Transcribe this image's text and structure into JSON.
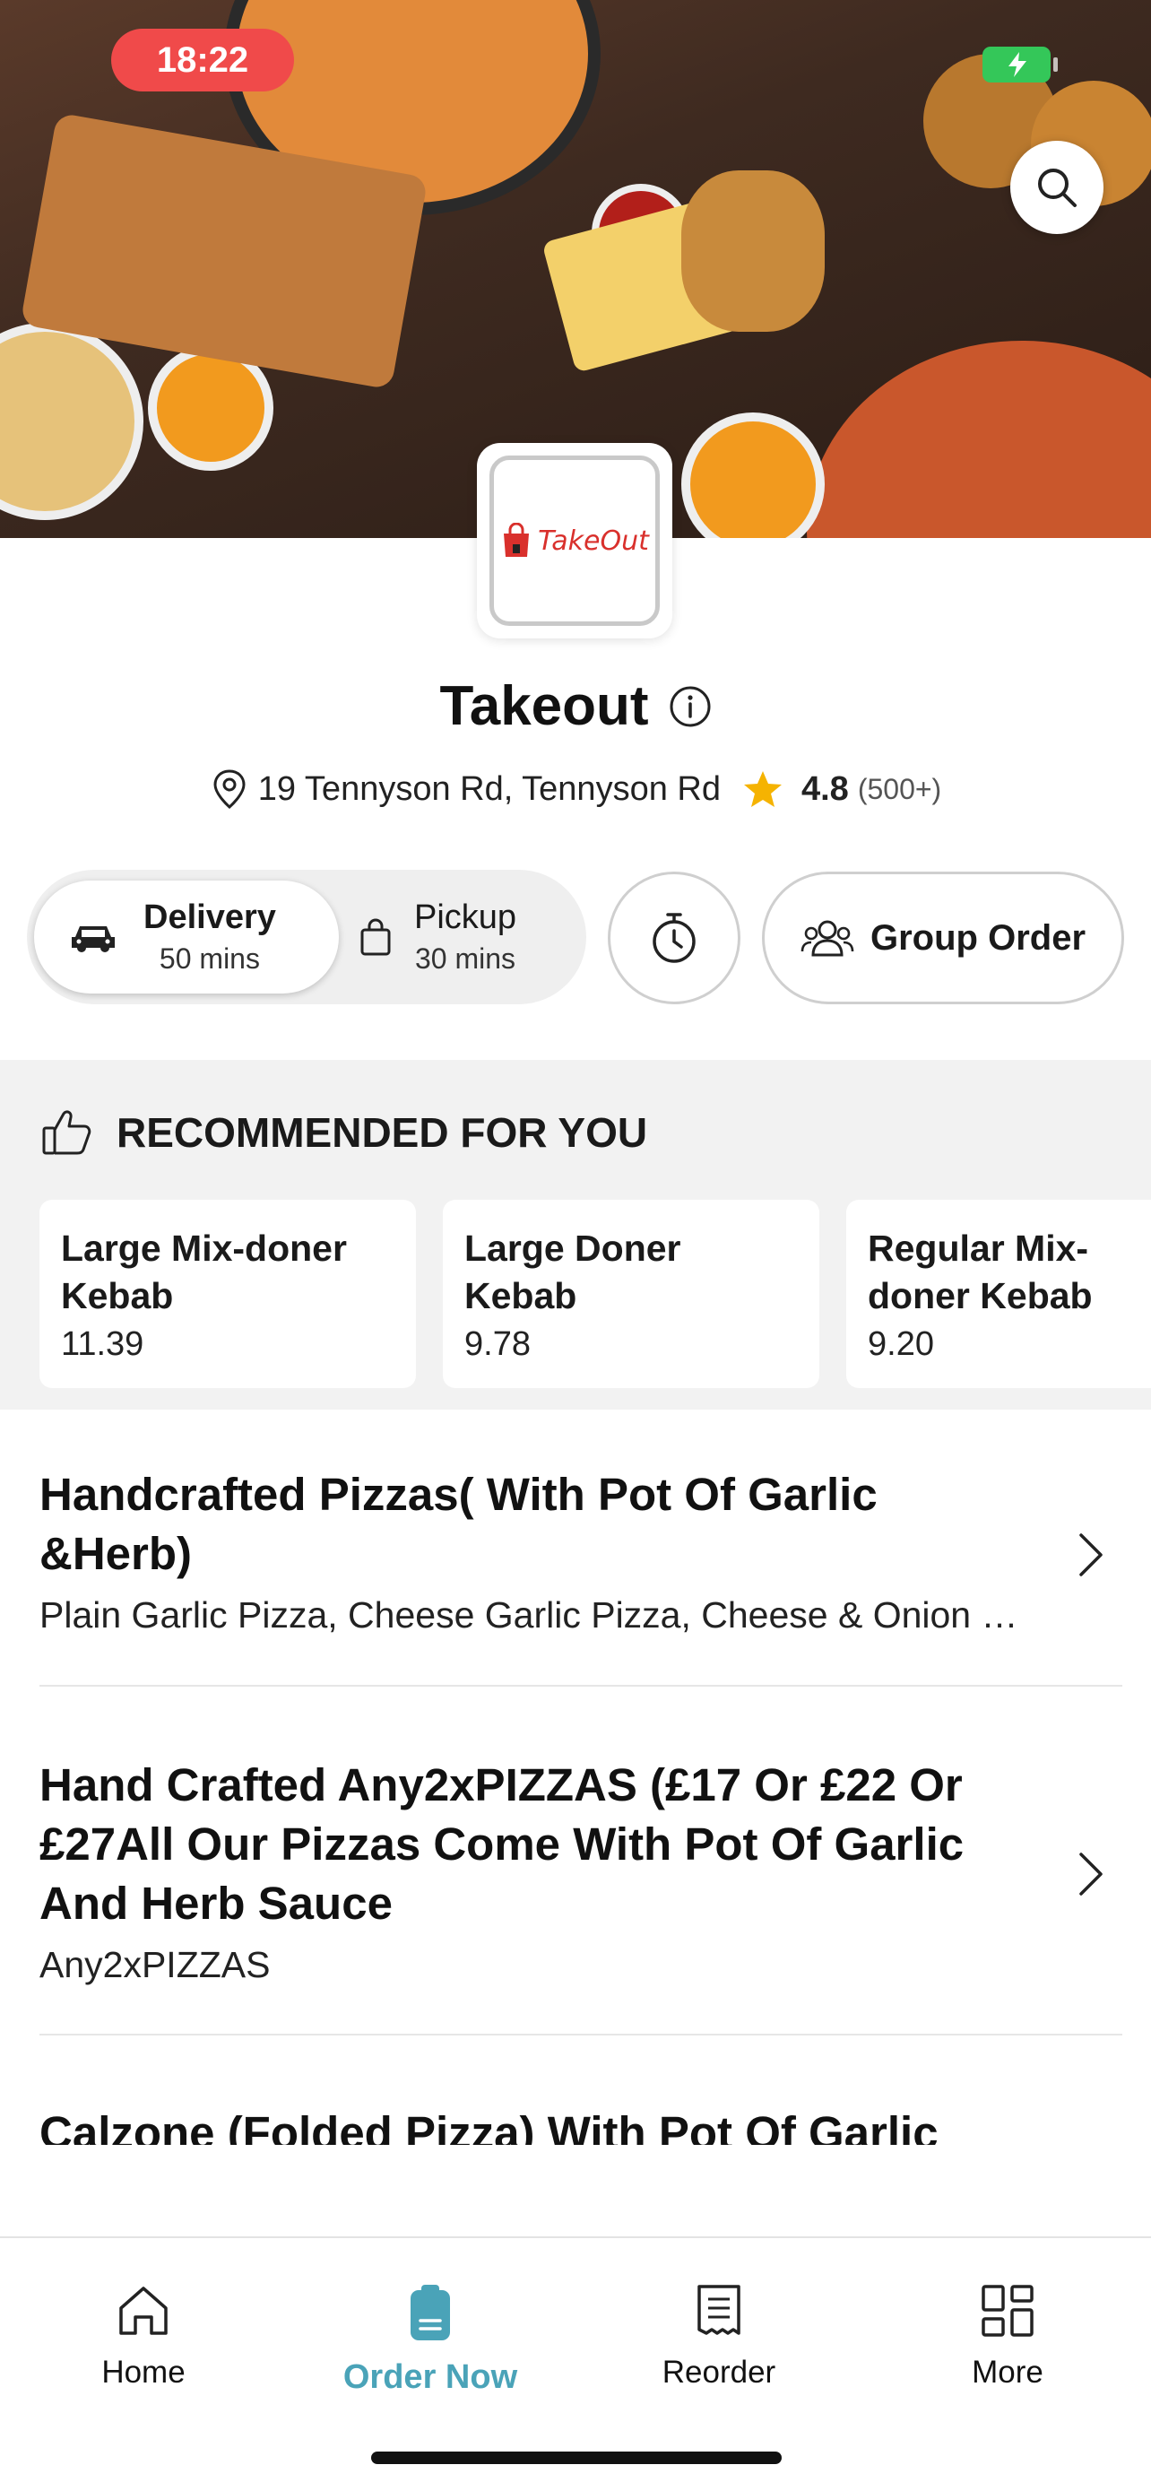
{
  "status_bar": {
    "time": "18:22"
  },
  "store": {
    "logo_text": "TakeOut",
    "name": "Takeout",
    "address": "19 Tennyson Rd, Tennyson Rd",
    "rating": "4.8",
    "rating_count": "(500+)"
  },
  "order_mode": {
    "delivery": {
      "label": "Delivery",
      "time": "50 mins",
      "selected": true
    },
    "pickup": {
      "label": "Pickup",
      "time": "30 mins",
      "selected": false
    },
    "group_order_label": "Group Order"
  },
  "recommended": {
    "title": "RECOMMENDED FOR YOU",
    "items": [
      {
        "name": "Large Mix-doner Kebab",
        "price": "11.39"
      },
      {
        "name": "Large Doner Kebab",
        "price": "9.78"
      },
      {
        "name": "Regular Mix-doner Kebab",
        "price": "9.20"
      }
    ]
  },
  "categories": [
    {
      "title": "Handcrafted Pizzas( With Pot Of Garlic &Herb)",
      "subtitle": "Plain Garlic Pizza, Cheese Garlic Pizza, Cheese & Onion Garlic Pizza"
    },
    {
      "title": "Hand Crafted Any2xPIZZAS (£17 Or £22 Or £27All Our Pizzas Come With Pot Of Garlic And Herb Sauce",
      "subtitle": "Any2xPIZZAS"
    },
    {
      "title": "Calzone (Folded Pizza) With Pot Of Garlic",
      "subtitle": ""
    }
  ],
  "bottom_nav": [
    {
      "label": "Home",
      "icon": "home-icon",
      "active": false
    },
    {
      "label": "Order Now",
      "icon": "order-icon",
      "active": true
    },
    {
      "label": "Reorder",
      "icon": "receipt-icon",
      "active": false
    },
    {
      "label": "More",
      "icon": "grid-icon",
      "active": false
    }
  ],
  "colors": {
    "accent": "#4aa3b8",
    "status_time_pill": "#f04a4a",
    "battery": "#34c759",
    "star": "#f5b301"
  }
}
